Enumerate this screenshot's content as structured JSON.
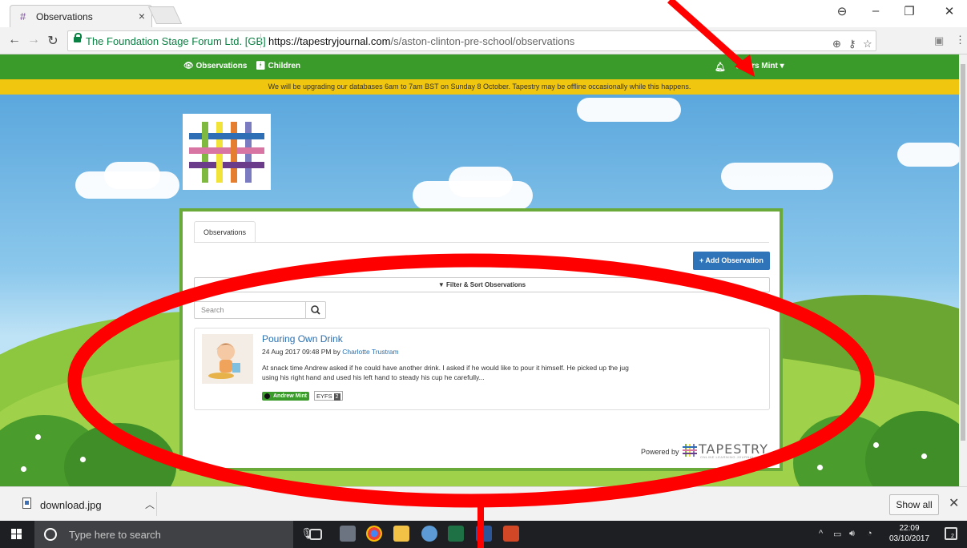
{
  "browser": {
    "tab_title": "Observations",
    "url_secure_label": "The Foundation Stage Forum Ltd. [GB]",
    "url_host": "https://tapestryjournal.com",
    "url_path": "/s/aston-clinton-pre-school/observations"
  },
  "site_nav": {
    "observations_label": "Observations",
    "children_label": "Children",
    "user_label": "Mrs Mint"
  },
  "banner": {
    "text": "We will be upgrading our databases 6am to 7am BST on Sunday 8 October. Tapestry may be offline occasionally while this happens."
  },
  "panel": {
    "tab_label": "Observations",
    "add_button_label": "+ Add Observation",
    "filter_label": "Filter & Sort Observations",
    "search_placeholder": "Search",
    "observation": {
      "title": "Pouring Own Drink",
      "date": "24 Aug 2017 09:48 PM by",
      "author": "Charlotte Trustram",
      "body": "At snack time Andrew asked if he could have another drink. I asked if he would like to pour it himself. He picked up the jug using his right hand and used his left hand to steady his cup he carefully...",
      "child_tag": "Andrew Mint",
      "eyfs_label": "EYFS",
      "eyfs_count": "2"
    },
    "powered_by": "Powered by",
    "brand": "TAPESTRY",
    "brand_sub": "ONLINE LEARNING JOURNAL"
  },
  "download_bar": {
    "file_name": "download.jpg",
    "show_all_label": "Show all"
  },
  "taskbar": {
    "search_placeholder": "Type here to search",
    "time": "22:09",
    "date": "03/10/2017",
    "notification_count": "2"
  },
  "colors": {
    "nav_green": "#3a9b2b",
    "banner_yellow": "#f0c60e",
    "button_blue": "#2f73b8",
    "link_blue": "#2a6fb0",
    "panel_border": "#6aaa3a",
    "annotation_red": "#ff0000"
  }
}
